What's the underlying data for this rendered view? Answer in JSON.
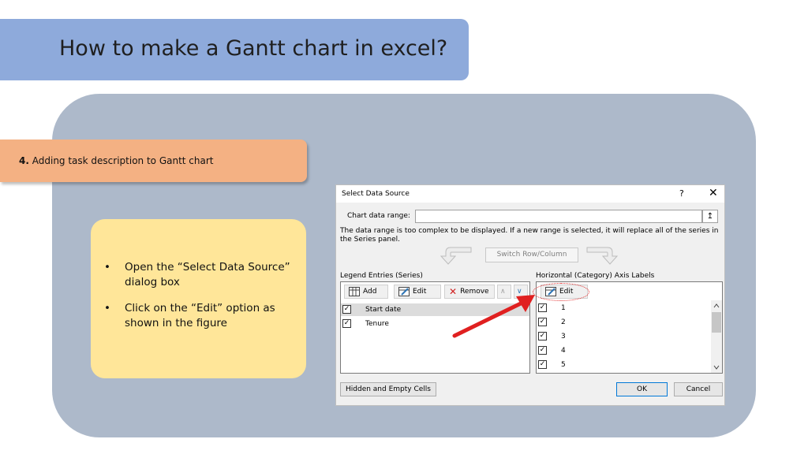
{
  "title": "How to make a Gantt chart in excel?",
  "step": {
    "number": "4.",
    "text": "Adding task description to Gantt chart"
  },
  "notes": [
    "Open the “Select Data Source” dialog box",
    "Click on the “Edit” option as shown in the figure"
  ],
  "bullet": "•",
  "dialog": {
    "title": "Select Data Source",
    "help": "?",
    "close": "✕",
    "range_label": "Chart data range:",
    "range_value": "",
    "collapse_icon": "↥",
    "info": "The data range is too complex to be displayed. If a new range is selected, it will replace all of the series in the Series panel.",
    "switch_label": "Switch Row/Column",
    "legend": {
      "label": "Legend Entries (Series)",
      "add": "Add",
      "edit": "Edit",
      "remove": "Remove",
      "up": "∧",
      "down": "∨",
      "series": [
        "Start date",
        "Tenure"
      ]
    },
    "axis": {
      "label": "Horizontal (Category) Axis Labels",
      "edit": "Edit",
      "items": [
        "1",
        "2",
        "3",
        "4",
        "5"
      ]
    },
    "hidden_cells": "Hidden and Empty Cells",
    "ok": "OK",
    "cancel": "Cancel",
    "check": "✓"
  },
  "colors": {
    "title_banner": "#8eaadb",
    "main_panel": "#adb9ca",
    "step_banner": "#f4b183",
    "note_box": "#ffe699",
    "highlight": "#e02020"
  }
}
